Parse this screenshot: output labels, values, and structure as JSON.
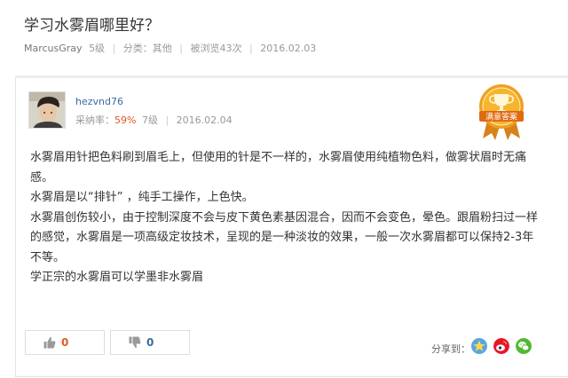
{
  "question": {
    "title": "学习水雾眉哪里好？",
    "author": "MarcusGray",
    "level": "5级",
    "category": "分类：其他",
    "views": "被浏览43次",
    "date": "2016.02.03"
  },
  "answer": {
    "username": "hezvnd76",
    "adoption_label": "采纳率：",
    "adoption_rate": "59%",
    "level": "7级",
    "date": "2016.02.04",
    "badge_text": "满意答案",
    "paragraphs": [
      "水雾眉用针把色料刷到眉毛上，但使用的针是不一样的，水雾眉使用纯植物色料，做雾状眉时无痛感。",
      "水雾眉是以“排针” ，纯手工操作，上色快。",
      "水雾眉创伤较小，由于控制深度不会与皮下黄色素基因混合，因而不会变色，晕色。跟眉粉扫过一样的感觉，水雾眉是一项高级定妆技术，呈现的是一种淡妆的效果，一般一次水雾眉都可以保持2-3年不等。",
      "学正宗的水雾眉可以学墨非水雾眉"
    ]
  },
  "votes": {
    "up_count": "0",
    "down_count": "0"
  },
  "share": {
    "label": "分享到：",
    "icons": [
      "qzone-star-icon",
      "weibo-icon",
      "wechat-icon"
    ]
  },
  "colors": {
    "accent_orange": "#e4581d",
    "link_blue": "#3a6a9e",
    "badge_gold": "#f0a020"
  }
}
